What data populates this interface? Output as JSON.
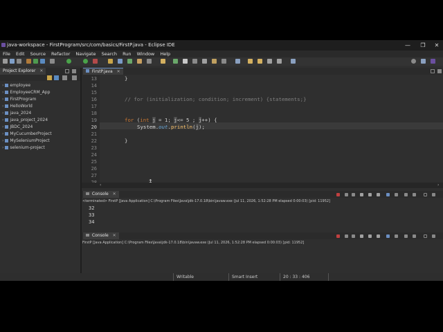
{
  "window": {
    "title": "java-workspace - FirstProgram/src/com/basics/FirstP.java - Eclipse IDE",
    "minimize": "—",
    "maximize": "❐",
    "close": "✕"
  },
  "menu": [
    "File",
    "Edit",
    "Source",
    "Refactor",
    "Navigate",
    "Search",
    "Run",
    "Window",
    "Help"
  ],
  "project_explorer": {
    "title": "Project Explorer",
    "items": [
      "employee",
      "EmployeeCRM_App",
      "FirstProgram",
      "HelloWorld",
      "java_2024",
      "java_project_2024",
      "JBDC_2024",
      "MyCucumberProject",
      "MySeleniumProject",
      "selenium-project"
    ]
  },
  "editor": {
    "tab_label": "FirstP.java",
    "lines": [
      {
        "n": "13",
        "text": "}"
      },
      {
        "n": "14",
        "text": ""
      },
      {
        "n": "15",
        "text": ""
      },
      {
        "n": "16",
        "text": "// for (initialization; condition; increment) {statements;}"
      },
      {
        "n": "17",
        "text": ""
      },
      {
        "n": "18",
        "text": ""
      },
      {
        "n": "19",
        "text": "for (int j = 1; j<= 5 ; j++) {"
      },
      {
        "n": "20",
        "text": "System.out.println(j);"
      },
      {
        "n": "21",
        "text": ""
      },
      {
        "n": "22",
        "text": "}"
      },
      {
        "n": "23",
        "text": ""
      },
      {
        "n": "24",
        "text": ""
      },
      {
        "n": "25",
        "text": ""
      },
      {
        "n": "26",
        "text": ""
      },
      {
        "n": "27",
        "text": ""
      },
      {
        "n": "28",
        "text": ""
      }
    ],
    "code": {
      "l13": "}",
      "l16": "// for (initialization; condition; increment) {statements;}",
      "l19_kw": "for",
      "l19_a": " (",
      "l19_int": "int",
      "l19_b": " ",
      "l19_j1": "j",
      "l19_c": " = 1; ",
      "l19_j2": "j",
      "l19_d": "<= 5 ; ",
      "l19_j3": "j",
      "l19_e": "++) {",
      "l20_sys": "System",
      "l20_dot1": ".",
      "l20_out": "out",
      "l20_dot2": ".",
      "l20_pr": "println",
      "l20_p": "(",
      "l20_j": "j",
      "l20_end": ");",
      "l22": "}"
    }
  },
  "console1": {
    "tab_label": "Console",
    "process": "<terminated> FirstP [Java Application] C:\\Program Files\\Java\\jdk-17.0.18\\bin\\javaw.exe  (Jul 11, 2026, 1:52:28 PM elapsed 0:00:03) [pid: 11952]",
    "lines": [
      "32",
      "33",
      "34"
    ]
  },
  "console2": {
    "tab_label": "Console",
    "process": "FirstP [Java Application] C:\\Program Files\\Java\\jdk-17.0.18\\bin\\javaw.exe  (Jul 11, 2026, 1:52:28 PM elapsed 0:00:03) [pid: 11952]"
  },
  "status": {
    "writable": "Writable",
    "insert_mode": "Smart Insert",
    "position": "20 : 33 : 406"
  },
  "colors": {
    "background": "#2f2f2f",
    "keyword": "#cc7832",
    "comment": "#808080",
    "field": "#66a6d8",
    "method": "#ffc66d"
  }
}
